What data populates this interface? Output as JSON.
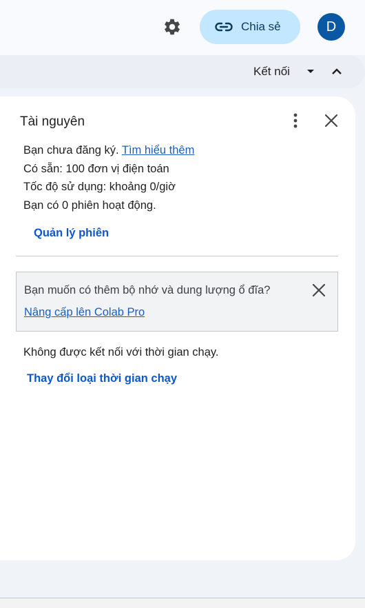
{
  "header": {
    "share_label": "Chia sẻ",
    "avatar_letter": "D"
  },
  "connection": {
    "label": "Kết nối"
  },
  "panel": {
    "title": "Tài nguyên",
    "line1_text": "Bạn chưa đăng ký.",
    "line1_link": "Tìm hiểu thêm",
    "line2": "Có sẵn: 100 đơn vị điện toán",
    "line3": "Tốc độ sử dụng: khoảng 0/giờ",
    "line4": "Bạn có 0 phiên hoạt động.",
    "manage_sessions": "Quản lý phiên",
    "promo_text": "Bạn muốn có thêm bộ nhớ và dung lượng ổ đĩa?",
    "promo_link": "Nâng cấp lên Colab Pro",
    "runtime_status": "Không được kết nối với thời gian chạy.",
    "change_runtime": "Thay đổi loại thời gian chạy"
  },
  "icons": [
    "settings-icon",
    "link-icon",
    "dropdown-icon",
    "collapse-icon",
    "more-vert-icon",
    "close-icon"
  ],
  "colors": {
    "accent": "#0b57d0",
    "share_bg": "#c2e7ff",
    "avatar_bg": "#0a57a3",
    "link": "#1a5fbd"
  }
}
